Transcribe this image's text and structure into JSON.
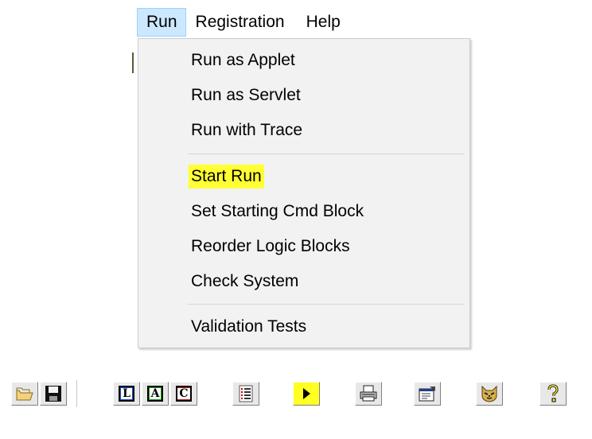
{
  "menubar": {
    "items": [
      {
        "label": "Run",
        "open": true
      },
      {
        "label": "Registration"
      },
      {
        "label": "Help"
      }
    ]
  },
  "run_menu": {
    "items": [
      {
        "label": "Run as Applet"
      },
      {
        "label": "Run as Servlet"
      },
      {
        "label": "Run with Trace"
      },
      {
        "label": "Start Run",
        "highlighted": true
      },
      {
        "label": "Set Starting Cmd Block"
      },
      {
        "label": "Reorder Logic Blocks"
      },
      {
        "label": "Check System"
      },
      {
        "label": "Validation Tests"
      }
    ],
    "highlight_color": "#ffff33"
  },
  "toolbar": {
    "buttons": [
      {
        "icon": "open-folder-icon"
      },
      {
        "icon": "save-disk-icon"
      },
      {
        "icon": "logic-block-icon",
        "letter": "L",
        "color": "#1a4fd6"
      },
      {
        "icon": "action-block-icon",
        "letter": "A",
        "color": "#1a9a1a"
      },
      {
        "icon": "cmd-block-icon",
        "letter": "C",
        "color": "#d01818"
      },
      {
        "icon": "list-icon"
      },
      {
        "icon": "play-icon",
        "background": "#ffff22"
      },
      {
        "icon": "printer-icon"
      },
      {
        "icon": "properties-icon"
      },
      {
        "icon": "cat-face-icon"
      },
      {
        "icon": "help-question-icon"
      }
    ]
  }
}
